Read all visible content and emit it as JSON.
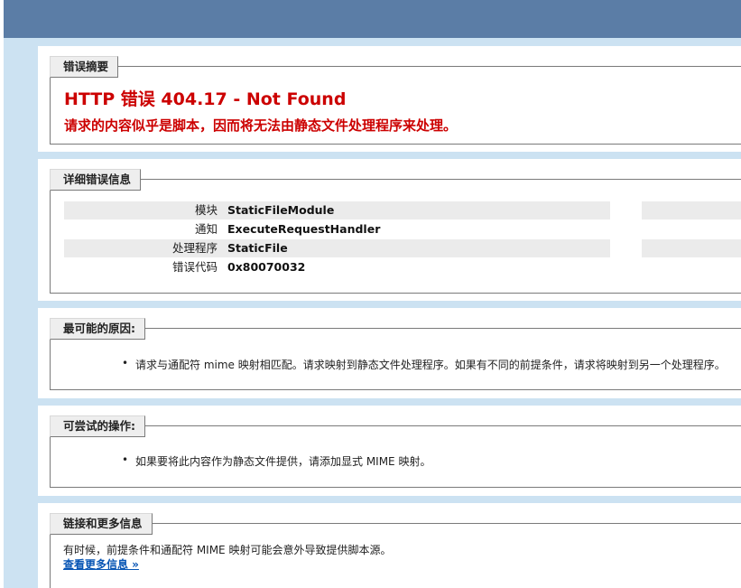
{
  "summary": {
    "legend": "错误摘要",
    "title": "HTTP 错误 404.17 - Not Found",
    "description": "请求的内容似乎是脚本，因而将无法由静态文件处理程序来处理。"
  },
  "details": {
    "legend": "详细错误信息",
    "rows": [
      {
        "label": "模块",
        "value": "StaticFileModule"
      },
      {
        "label": "通知",
        "value": "ExecuteRequestHandler"
      },
      {
        "label": "处理程序",
        "value": "StaticFile"
      },
      {
        "label": "错误代码",
        "value": "0x80070032"
      }
    ]
  },
  "causes": {
    "legend": "最可能的原因:",
    "items": [
      "请求与通配符 mime 映射相匹配。请求映射到静态文件处理程序。如果有不同的前提条件，请求将映射到另一个处理程序。"
    ]
  },
  "actions": {
    "legend": "可尝试的操作:",
    "items": [
      "如果要将此内容作为静态文件提供，请添加显式 MIME 映射。"
    ]
  },
  "links": {
    "legend": "链接和更多信息",
    "text": "有时候，前提条件和通配符 MIME 映射可能会意外导致提供脚本源。",
    "more_link": "查看更多信息 »"
  },
  "colors": {
    "header": "#5b7da6",
    "background": "#cce2f2",
    "error_red": "#cc0000",
    "link_blue": "#0654b4"
  }
}
